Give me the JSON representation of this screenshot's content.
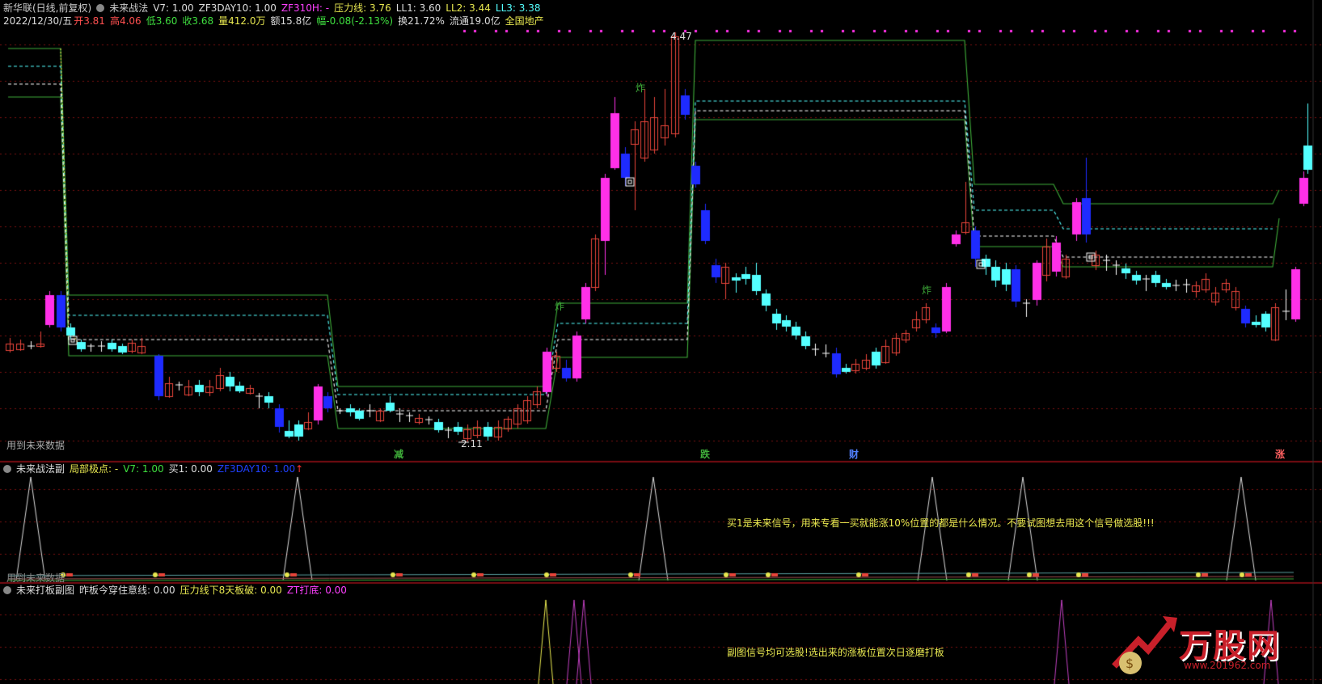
{
  "colors": {
    "up": "#e8443a",
    "down_blue": "#1e2bff",
    "down_cyan": "#54ffff",
    "magenta": "#ff30e8",
    "green": "#3fae3a",
    "white": "#ffffff",
    "yellow": "#e8e850",
    "purple": "#c040c0",
    "grid_red": "#7a1010",
    "divider": "#a01018"
  },
  "main": {
    "title_row": {
      "stock": "新华联(日线,前复权)",
      "indicator": "未来战法",
      "v7": "V7: 1.00",
      "zf3day": "ZF3DAY10: 1.00",
      "zf3": "ZF310H: -",
      "pressure": "压力线: 3.76",
      "ll1": "LL1: 3.60",
      "ll2": "LL2: 3.44",
      "ll3": "LL3: 3.38"
    },
    "quote_row": {
      "date": "2022/12/30/五",
      "open": "开3.81",
      "high": "高4.06",
      "low": "低3.60",
      "close": "收3.68",
      "volume": "量412.0万",
      "amount": "额15.8亿",
      "change": "幅-0.08(-2.13%)",
      "turnover": "换21.72%",
      "float": "流通19.0亿",
      "sector": "全国地产"
    },
    "price_high": "4.47",
    "price_low": "2.11",
    "future_data_note": "用到未来数据",
    "zha_label": "炸",
    "bottom_labels": [
      {
        "text": "减",
        "color": "#3fae3a"
      },
      {
        "text": "跌",
        "color": "#3fae3a"
      },
      {
        "text": "财",
        "color": "#5080ff"
      },
      {
        "text": "涨",
        "color": "#ff6060"
      }
    ]
  },
  "sub1": {
    "name": "未来战法副",
    "local_extreme": "局部极点: -",
    "v7": "V7: 1.00",
    "buy1": "买1: 0.00",
    "zf3day": "ZF3DAY10: 1.00",
    "arrow": "↑",
    "note": "买1是未来信号，用来专看一买就能涨10%位置的都是什么情况。不要试图想去用这个信号做选股!!!",
    "future_data_note": "用到未来数据",
    "buy_marker": "买"
  },
  "sub2": {
    "name": "未来打板副图",
    "yesterday_board": "昨板今穿住意线: 0.00",
    "pressure_break": "压力线下8天板破: 0.00",
    "zt_bottom": "ZT打底: 0.00",
    "note": "副图信号均可选股!选出来的涨板位置次日逐磨打板"
  },
  "watermark": {
    "brand": "万股网",
    "url": "www.201962.com"
  }
}
